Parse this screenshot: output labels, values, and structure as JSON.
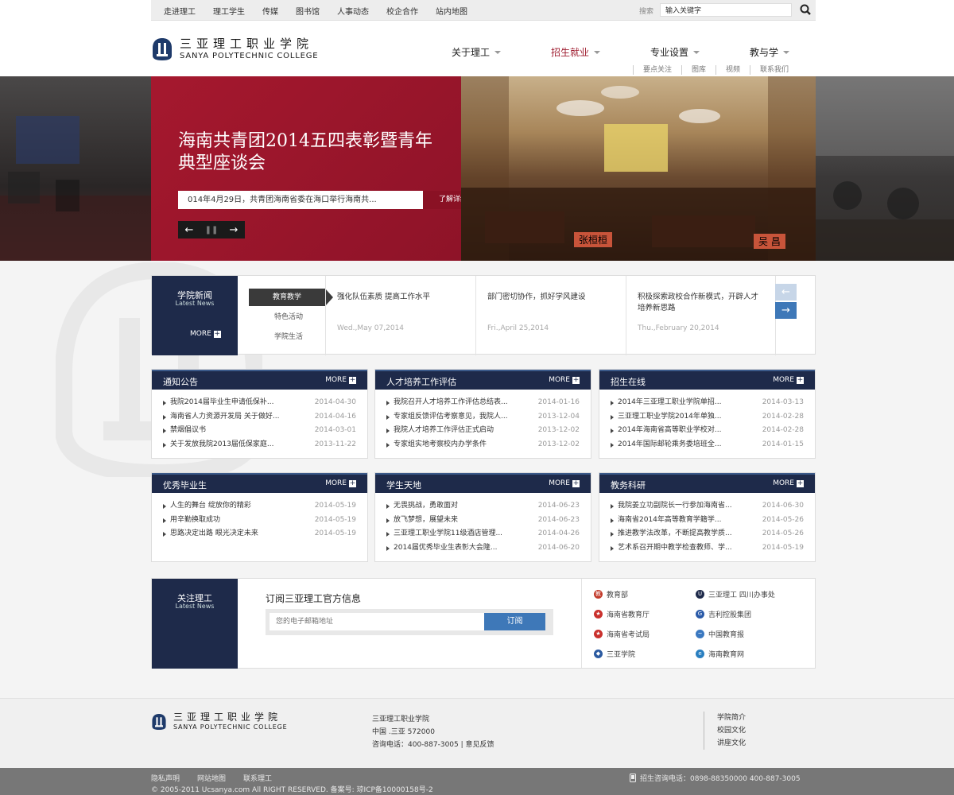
{
  "topbar": {
    "links": [
      "走进理工",
      "理工学生",
      "传媒",
      "图书馆",
      "人事动态",
      "校企合作",
      "站内地图"
    ],
    "search_label": "搜索",
    "search_value": "输入关键字"
  },
  "header": {
    "logo_cn": "三亚理工职业学院",
    "logo_en": "SANYA POLYTECHNIC COLLEGE",
    "nav": [
      {
        "label": "关于理工",
        "active": false
      },
      {
        "label": "招生就业",
        "active": true
      },
      {
        "label": "专业设置",
        "active": false
      },
      {
        "label": "教与学",
        "active": false
      }
    ],
    "subnav": [
      "要点关注",
      "图库",
      "视频",
      "联系我们"
    ]
  },
  "banner": {
    "title": "海南共青团2014五四表彰暨青年典型座谈会",
    "summary": "014年4月29日，共青团海南省委在海口举行海南共...",
    "more": "了解详细>>",
    "nameplates": [
      "张桓桓",
      "吴 昌"
    ]
  },
  "news": {
    "badge_cn": "学院新闻",
    "badge_en": "Latest News",
    "more": "MORE",
    "categories": [
      "教育教学",
      "特色活动",
      "学院生活"
    ],
    "items": [
      {
        "title": "强化队伍素质 提高工作水平",
        "date": "Wed.,May 07,2014"
      },
      {
        "title": "部门密切协作，抓好学风建设",
        "date": "Fri.,April 25,2014"
      },
      {
        "title": "积极探索政校合作新模式，开辟人才培养新思路",
        "date": "Thu.,February 20,2014"
      }
    ]
  },
  "panels": [
    {
      "title": "通知公告",
      "more": "MORE",
      "rows": [
        {
          "text": "我院2014届毕业生申请低保补...",
          "date": "2014-04-30"
        },
        {
          "text": "海南省人力资源开发局 关于做好...",
          "date": "2014-04-16"
        },
        {
          "text": "禁烟倡议书",
          "date": "2014-03-01"
        },
        {
          "text": "关于发放我院2013届低保家庭...",
          "date": "2013-11-22"
        }
      ]
    },
    {
      "title": "人才培养工作评估",
      "more": "MORE",
      "rows": [
        {
          "text": "我院召开人才培养工作评估总结表...",
          "date": "2014-01-16"
        },
        {
          "text": "专家组反馈评估考察意见，我院人...",
          "date": "2013-12-04"
        },
        {
          "text": "我院人才培养工作评估正式启动",
          "date": "2013-12-02"
        },
        {
          "text": "专家组实地考察校内办学条件",
          "date": "2013-12-02"
        }
      ]
    },
    {
      "title": "招生在线",
      "more": "MORE",
      "rows": [
        {
          "text": "2014年三亚理工职业学院单招...",
          "date": "2014-03-13"
        },
        {
          "text": "三亚理工职业学院2014年单独...",
          "date": "2014-02-28"
        },
        {
          "text": "2014年海南省高等职业学校对...",
          "date": "2014-02-28"
        },
        {
          "text": "2014年国际邮轮乘务委培班全...",
          "date": "2014-01-15"
        }
      ]
    },
    {
      "title": "优秀毕业生",
      "more": "MORE",
      "rows": [
        {
          "text": "人生的舞台 绽放你的精彩",
          "date": "2014-05-19"
        },
        {
          "text": "用辛勤换取成功",
          "date": "2014-05-19"
        },
        {
          "text": "思路决定出路 眼光决定未来",
          "date": "2014-05-19"
        }
      ]
    },
    {
      "title": "学生天地",
      "more": "MORE",
      "rows": [
        {
          "text": "无畏挑战，勇敢面对",
          "date": "2014-06-23"
        },
        {
          "text": "放飞梦想，展望未来",
          "date": "2014-06-23"
        },
        {
          "text": "三亚理工职业学院11级酒店管理...",
          "date": "2014-04-26"
        },
        {
          "text": "2014届优秀毕业生表彰大会隆...",
          "date": "2014-06-20"
        }
      ]
    },
    {
      "title": "教务科研",
      "more": "MORE",
      "rows": [
        {
          "text": "我院姜立功副院长一行参加海南省...",
          "date": "2014-06-30"
        },
        {
          "text": "海南省2014年高等教育学籍学...",
          "date": "2014-05-26"
        },
        {
          "text": "推进教学法改革，不断提高教学质...",
          "date": "2014-05-26"
        },
        {
          "text": "艺术系召开期中教学检查教师、学...",
          "date": "2014-05-19"
        }
      ]
    }
  ],
  "follow": {
    "badge_cn": "关注理工",
    "badge_en": "Latest News",
    "subscribe_title": "订阅三亚理工官方信息",
    "subscribe_placeholder": "您的电子邮箱地址",
    "subscribe_button": "订阅",
    "links": [
      {
        "label": "教育部",
        "icon": "ministry-of-education-icon",
        "color": "#c23a2a"
      },
      {
        "label": "三亚理工 四川办事处",
        "icon": "college-emblem-icon",
        "color": "#1e2a4a"
      },
      {
        "label": "海南省教育厅",
        "icon": "national-emblem-icon",
        "color": "#c9302c"
      },
      {
        "label": "吉利控股集团",
        "icon": "geely-logo-icon",
        "color": "#2a5aa8"
      },
      {
        "label": "海南省考试局",
        "icon": "national-emblem-icon",
        "color": "#c9302c"
      },
      {
        "label": "中国教育报",
        "icon": "education-news-icon",
        "color": "#3a78c0"
      },
      {
        "label": "三亚学院",
        "icon": "sanya-university-icon",
        "color": "#2b5aa0"
      },
      {
        "label": "海南教育网",
        "icon": "hainan-education-icon",
        "color": "#2a7fc0"
      }
    ]
  },
  "footer": {
    "logo_cn": "三亚理工职业学院",
    "logo_en": "SANYA POLYTECHNIC COLLEGE",
    "address_lines": [
      "三亚理工职业学院",
      "中国 .三亚 572000",
      "咨询电话：400-887-3005 | 意见反馈"
    ],
    "links": [
      "学院简介",
      "校园文化",
      "讲座文化"
    ],
    "bottom_links": [
      "隐私声明",
      "网站地图",
      "联系理工"
    ],
    "copyright": "© 2005-2011 Ucsanya.com All RIGHT RESERVED.  备案号: 琼ICP备10000158号-2",
    "phone": "招生咨询电话：0898-88350000 400-887-3005"
  }
}
